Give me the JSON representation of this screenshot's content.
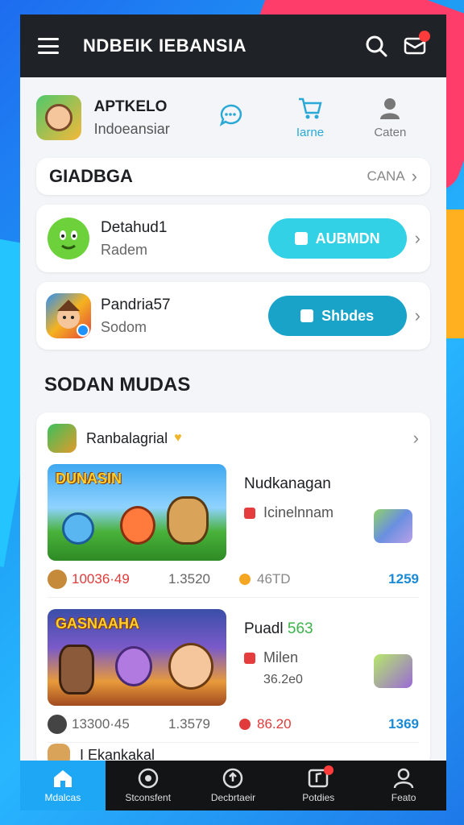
{
  "app": {
    "title": "NDBEIK IEBANSIA"
  },
  "profile": {
    "name": "APTKELO",
    "subtitle": "Indoeansiar",
    "actions": [
      {
        "label": "",
        "icon": "chat-icon"
      },
      {
        "label": "Iarne",
        "icon": "cart-icon"
      },
      {
        "label": "Caten",
        "icon": "user-icon"
      }
    ]
  },
  "section1": {
    "title": "GIADBGA",
    "more": "CANA"
  },
  "cards": [
    {
      "name": "Detahud1",
      "sub": "Radem",
      "button": "AUBMDN",
      "color": "#33d1e6"
    },
    {
      "name": "Pandria57",
      "sub": "Sodom",
      "button": "Shbdes",
      "color": "#1aa3c9"
    }
  ],
  "section2": {
    "title": "SODAN MUDAS"
  },
  "feed": {
    "user": "Ranbalagrial",
    "verified": "♥",
    "games": [
      {
        "banner_title": "DUNASIN",
        "title": "Nudkanagan",
        "sub": "Icinelnnam",
        "extra": "",
        "stats": {
          "a": "10036·49",
          "b": "1.3520",
          "c": "46TD",
          "d": "1259"
        }
      },
      {
        "banner_title": "GASNAAHA",
        "title": "Puadl",
        "title_accent": "563",
        "sub": "Milen",
        "extra": "36.2e0",
        "stats": {
          "a": "13300·45",
          "b": "1.3579",
          "c": "86.20",
          "d": "1369"
        }
      }
    ],
    "next_user": "I Ekankakal"
  },
  "tabs": [
    {
      "label": "Mdalcas",
      "icon": "home-icon",
      "active": true
    },
    {
      "label": "Stconsfent",
      "icon": "target-icon",
      "active": false
    },
    {
      "label": "Decbrtaeir",
      "icon": "upload-icon",
      "active": false
    },
    {
      "label": "Potdies",
      "icon": "music-icon",
      "active": false
    },
    {
      "label": "Feato",
      "icon": "profile-icon",
      "active": false
    }
  ],
  "colors": {
    "accent": "#1ea7f5",
    "topbar": "#1f2328",
    "alert": "#ff3b3b"
  }
}
